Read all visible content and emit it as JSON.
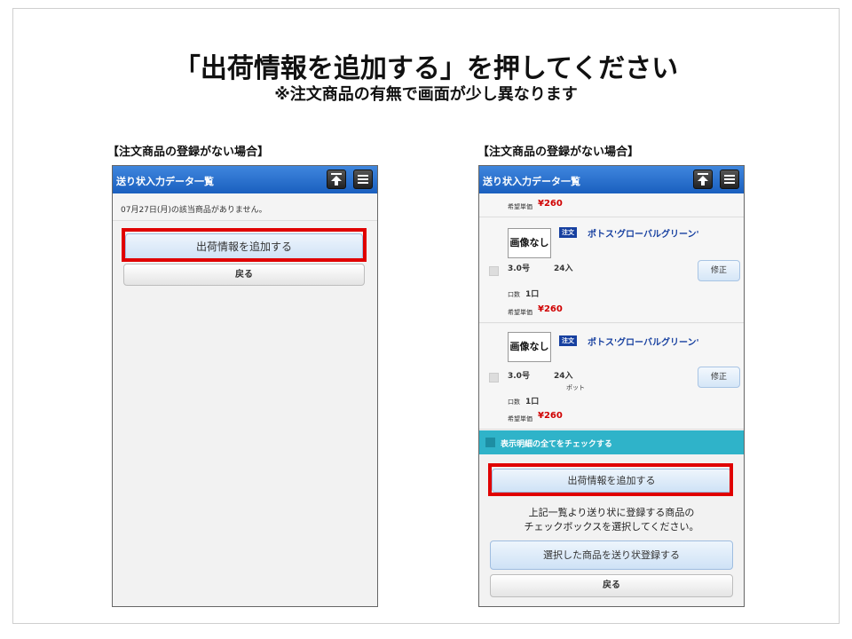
{
  "slide": {
    "title": "「出荷情報を追加する」を押してください",
    "subtitle": "※注文商品の有無で画面が少し異なります"
  },
  "left": {
    "caption": "【注文商品の登録がない場合】",
    "header_title": "送り状入力データ一覧",
    "date_message": "07月27日(月)の該当商品がありません。",
    "add_button": "出荷情報を追加する",
    "back_button": "戻る"
  },
  "right": {
    "caption": "【注文商品の登録がない場合】",
    "header_title": "送り状入力データ一覧",
    "top_price_label": "希望単価",
    "top_price": "¥260",
    "items": [
      {
        "no_image": "画像なし",
        "tag": "注文",
        "name": "ポトス'グローバルグリーン'",
        "size": "3.0号",
        "qty": "24入",
        "extra": "",
        "lots_label": "口数",
        "lots": "1口",
        "price_label": "希望単価",
        "price": "¥260",
        "fix_button": "修正"
      },
      {
        "no_image": "画像なし",
        "tag": "注文",
        "name": "ポトス'グローバルグリーン'",
        "size": "3.0号",
        "qty": "24入",
        "extra": "ポット",
        "lots_label": "口数",
        "lots": "1口",
        "price_label": "希望単価",
        "price": "¥260",
        "fix_button": "修正"
      }
    ],
    "check_all": "表示明細の全てをチェックする",
    "add_button": "出荷情報を追加する",
    "note_line1": "上記一覧より送り状に登録する商品の",
    "note_line2": "チェックボックスを選択してください。",
    "register_button": "選択した商品を送り状登録する",
    "back_button": "戻る"
  },
  "icons": {
    "scroll_top": "arrow-up-to-top-icon",
    "menu": "hamburger-menu-icon"
  },
  "colors": {
    "header_blue": "#1a5fbf",
    "highlight_red": "#e00000",
    "tag_navy": "#1740a0",
    "price_red": "#d00000",
    "teal": "#2fb3c9"
  }
}
